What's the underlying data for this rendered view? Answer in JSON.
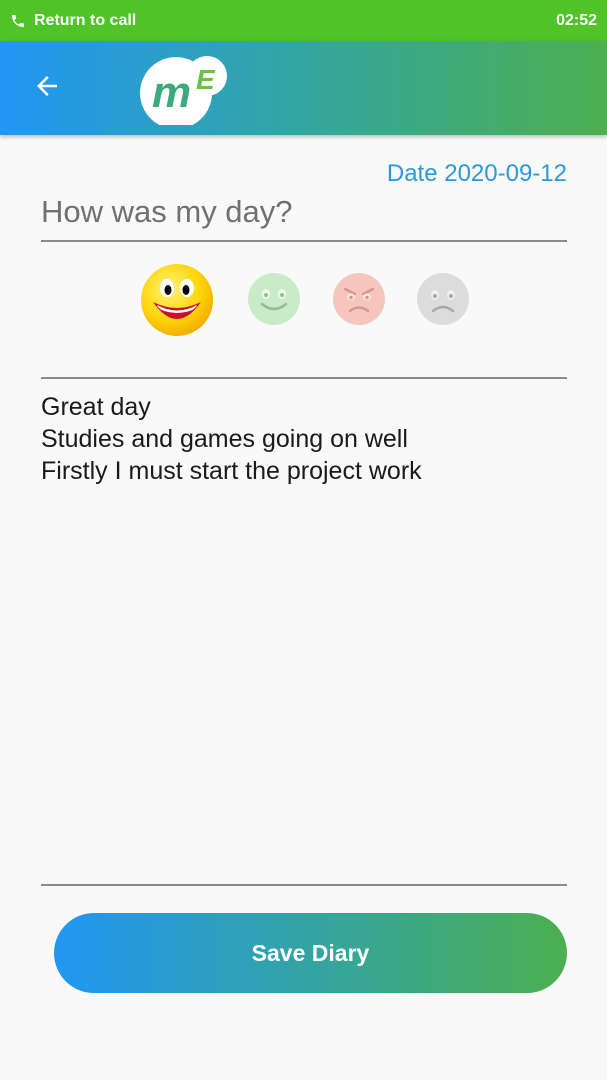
{
  "status_bar": {
    "call_text": "Return to call",
    "time": "02:52",
    "color": "#4fc327"
  },
  "app_bar": {
    "back_icon": "arrow-back-icon",
    "logo_text_main": "m",
    "logo_text_super": "E",
    "gradient": [
      "#2196f3",
      "#4caf50"
    ]
  },
  "diary": {
    "date_label": "Date 2020-09-12",
    "title_placeholder": "How was my day?",
    "moods": [
      {
        "name": "happy",
        "selected": true
      },
      {
        "name": "smile",
        "selected": false
      },
      {
        "name": "angry",
        "selected": false
      },
      {
        "name": "sad",
        "selected": false
      }
    ],
    "body_lines": [
      "Great day",
      "Studies and games going on well",
      "Firstly I must start the project work"
    ],
    "save_label": "Save Diary"
  }
}
